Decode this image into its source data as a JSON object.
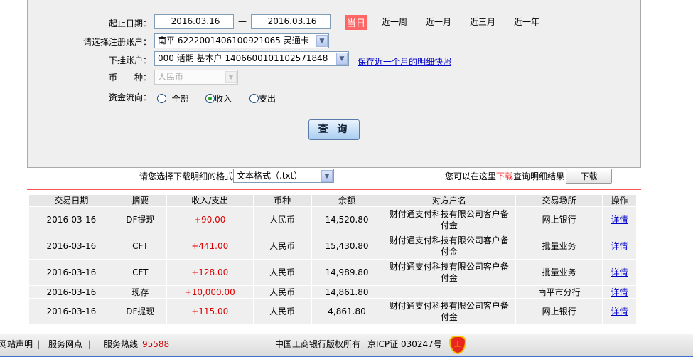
{
  "form": {
    "date_label": "起止日期：",
    "start_date": "2016.03.16",
    "dash": "—",
    "end_date": "2016.03.16",
    "quick": [
      {
        "label": "当日",
        "active": true
      },
      {
        "label": "近一周"
      },
      {
        "label": "近一月"
      },
      {
        "label": "近三月"
      },
      {
        "label": "近一年"
      }
    ],
    "account_label": "请选择注册账户：",
    "account_value": "南平 6222001406100921065 灵通卡",
    "sub_label": "下挂账户：",
    "sub_value": "000 活期 基本户 1406600101102571848",
    "snapshot_link": "保存近一个月的明细快照",
    "currency_label": "币　　种：",
    "currency_value": "人民币",
    "flow_label": "资金流向：",
    "flow_options": [
      {
        "label": "全部",
        "checked": false
      },
      {
        "label": "收入",
        "checked": true
      },
      {
        "label": "支出",
        "checked": false
      }
    ],
    "query_button": "查 询"
  },
  "download": {
    "format_label": "请您选择下载明细的格式",
    "format_value": "文本格式（.txt）",
    "hint_pre": "您可以在这里",
    "hint_link": "下载",
    "hint_post": "查询明细结果",
    "button": "下载"
  },
  "table": {
    "headers": [
      "交易日期",
      "摘要",
      "收入/支出",
      "币种",
      "余额",
      "对方户名",
      "交易场所",
      "操作"
    ],
    "rows": [
      [
        "2016-03-16",
        "DF提现",
        "+90.00",
        "人民币",
        "14,520.80",
        "财付通支付科技有限公司客户备付金",
        "网上银行",
        "详情"
      ],
      [
        "2016-03-16",
        "CFT",
        "+441.00",
        "人民币",
        "15,430.80",
        "财付通支付科技有限公司客户备付金",
        "批量业务",
        "详情"
      ],
      [
        "2016-03-16",
        "CFT",
        "+128.00",
        "人民币",
        "14,989.80",
        "财付通支付科技有限公司客户备付金",
        "批量业务",
        "详情"
      ],
      [
        "2016-03-16",
        "现存",
        "+10,000.00",
        "人民币",
        "14,861.80",
        "",
        "南平市分行",
        "详情"
      ],
      [
        "2016-03-16",
        "DF提现",
        "+115.00",
        "人民币",
        "4,861.80",
        "财付通支付科技有限公司客户备付金",
        "网上银行",
        "详情"
      ]
    ]
  },
  "footer": {
    "links": [
      "网站声明",
      "服务网点"
    ],
    "hotline_label": "服务热线",
    "hotline": "95588",
    "copyright": "中国工商银行版权所有",
    "icp": "京ICP证 030247号"
  },
  "colors": {
    "accent_red": "#ff6666",
    "amount_red": "#dd0000",
    "link": "#0000cc"
  }
}
